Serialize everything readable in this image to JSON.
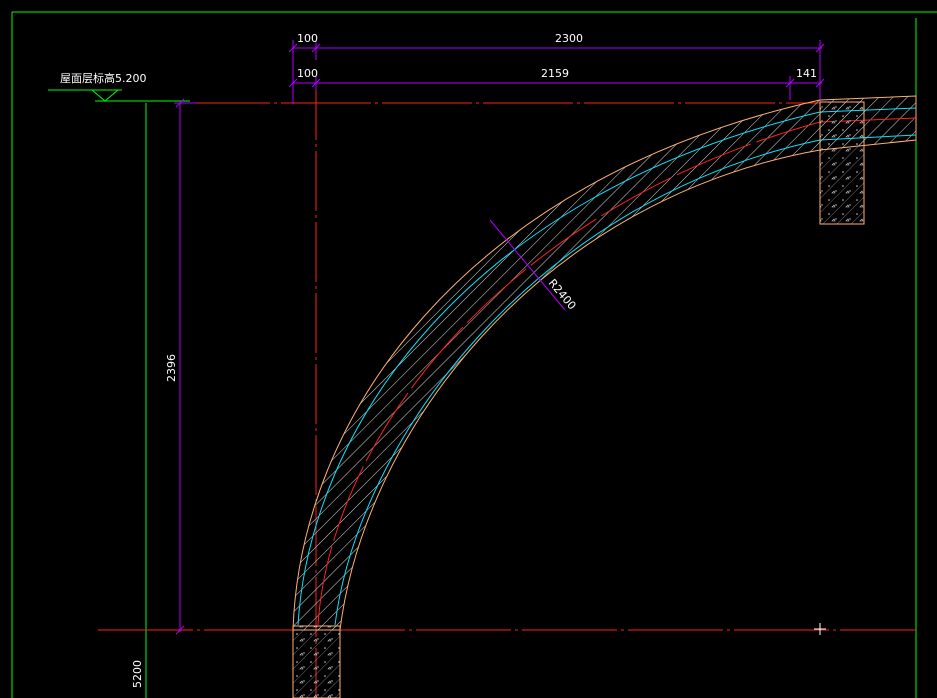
{
  "drawing": {
    "level_label": "屋面层标高5.200",
    "dims_top": {
      "row1_left": "100",
      "row1_main": "2300",
      "row2_left": "100",
      "row2_main": "2159",
      "row2_right": "141"
    },
    "dim_vertical_main": "2396",
    "dim_vertical_lower": "5200",
    "radius_label": "R2400",
    "colors": {
      "background": "#000000",
      "frame": "#00ff00",
      "dimension": "#b000ff",
      "axis": "#ff2020",
      "slab_edge": "#00e5ff",
      "outline": "#ffb070",
      "text": "#ffffff"
    }
  }
}
